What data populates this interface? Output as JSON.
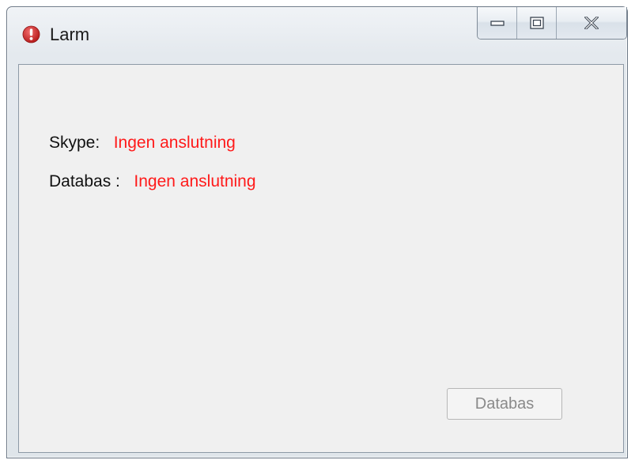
{
  "window": {
    "title": "Larm",
    "icon": "error-exclamation-icon",
    "caption_buttons": [
      "minimize-icon",
      "maximize-icon",
      "close-icon"
    ]
  },
  "status": {
    "skype_label": "Skype:",
    "skype_value": "Ingen anslutning",
    "database_label": "Databas :",
    "database_value": "Ingen anslutning"
  },
  "button": {
    "database_label": "Databas",
    "state": "disabled"
  },
  "colors": {
    "status_error": "#ff1a1a",
    "client_background": "#f0f0f0",
    "disabled_text": "#8a8a8a",
    "app_icon": "#c62828"
  }
}
